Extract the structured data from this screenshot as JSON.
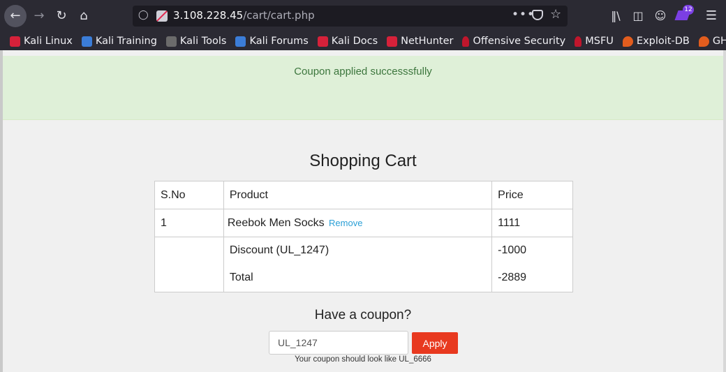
{
  "browser": {
    "url_host": "3.108.228.45",
    "url_path": "/cart/cart.php",
    "extension_badge": "12",
    "icons": [
      "back-icon",
      "forward-icon",
      "reload-icon",
      "home-icon",
      "shield-icon",
      "insecure-lock-icon",
      "more-dots-icon",
      "pocket-icon",
      "bookmark-star-icon",
      "library-icon",
      "sidebar-icon",
      "account-icon",
      "extension-icon",
      "menu-icon"
    ]
  },
  "bookmarks": [
    {
      "label": "Kali Linux",
      "icon": "kali-icon"
    },
    {
      "label": "Kali Training",
      "icon": "kali-training-icon"
    },
    {
      "label": "Kali Tools",
      "icon": "kali-tools-icon"
    },
    {
      "label": "Kali Forums",
      "icon": "kali-forums-icon"
    },
    {
      "label": "Kali Docs",
      "icon": "kali-docs-icon"
    },
    {
      "label": "NetHunter",
      "icon": "nethunter-icon"
    },
    {
      "label": "Offensive Security",
      "icon": "offsec-icon"
    },
    {
      "label": "MSFU",
      "icon": "msfu-icon"
    },
    {
      "label": "Exploit-DB",
      "icon": "exploitdb-icon"
    },
    {
      "label": "GHDB",
      "icon": "ghdb-icon"
    }
  ],
  "alert": {
    "message": "Coupon applied successsfully",
    "color": "#3c763d",
    "background": "#dff0d8"
  },
  "cart": {
    "title": "Shopping Cart",
    "headers": [
      "S.No",
      "Product",
      "Price"
    ],
    "items": [
      {
        "sno": "1",
        "product": "Reebok Men Socks",
        "remove_label": "Remove",
        "price": "1111"
      }
    ],
    "discount_label": "Discount (UL_1247)",
    "discount_value": "-1000",
    "total_label": "Total",
    "total_value": "-2889"
  },
  "coupon": {
    "title": "Have a coupon?",
    "input_value": "UL_1247",
    "apply_label": "Apply",
    "hint": "Your coupon should look like UL_6666",
    "button_color": "#e8391f"
  }
}
